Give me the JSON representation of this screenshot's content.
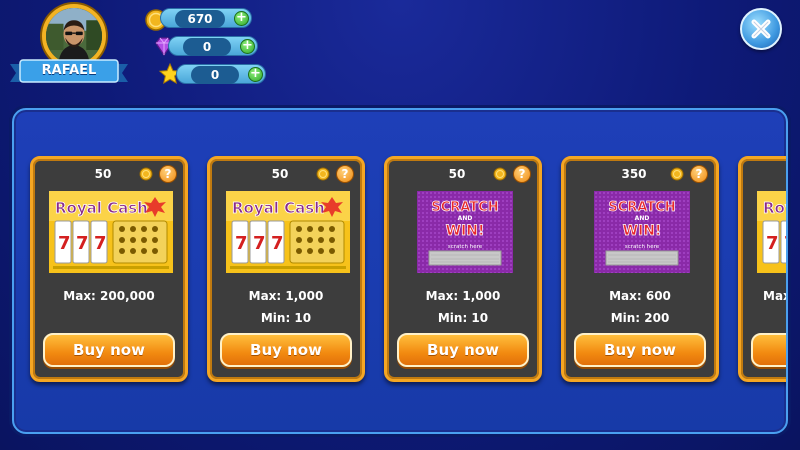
{
  "player": {
    "name": "RAFAEL"
  },
  "currencies": [
    {
      "name": "coins",
      "value": "670",
      "icon": "coin-icon"
    },
    {
      "name": "gems",
      "value": "0",
      "icon": "gem-icon"
    },
    {
      "name": "stars",
      "value": "0",
      "icon": "star-icon"
    }
  ],
  "plus_label": "+",
  "help_label": "?",
  "tickets": [
    {
      "price": "50",
      "kind": "royal-cash",
      "art_title": "Royal Cash",
      "max": "Max: 200,000",
      "min": "",
      "buy_label": "Buy now"
    },
    {
      "price": "50",
      "kind": "royal-cash",
      "art_title": "Royal Cash",
      "max": "Max: 1,000",
      "min": "Min: 10",
      "buy_label": "Buy now"
    },
    {
      "price": "50",
      "kind": "scratch-win",
      "art_title": "SCRATCH AND WIN!",
      "art_sub": "scratch here",
      "max": "Max: 1,000",
      "min": "Min: 10",
      "buy_label": "Buy now"
    },
    {
      "price": "350",
      "kind": "scratch-win",
      "art_title": "SCRATCH AND WIN!",
      "art_sub": "scratch here",
      "max": "Max: 600",
      "min": "Min: 200",
      "buy_label": "Buy now"
    },
    {
      "price": "",
      "kind": "royal-cash",
      "art_title": "Royal Cash",
      "max": "Max",
      "min": "",
      "buy_label": ""
    }
  ],
  "colors": {
    "background": "#0e1a78",
    "panel": "#1e3fb8",
    "card_border": "#f5a623",
    "card_bg": "#3d3d3d",
    "buy_button": "#f28a10",
    "scratch_purple": "#8a2aa8",
    "royal_yellow": "#f7c21a"
  }
}
